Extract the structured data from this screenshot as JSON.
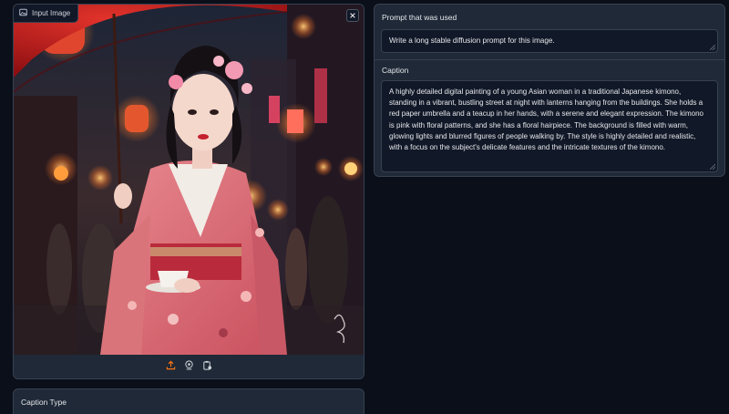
{
  "image_panel": {
    "label": "Input Image",
    "label_icon": "image-icon",
    "close_icon": "close-icon",
    "toolbar": [
      "upload-icon",
      "webcam-icon",
      "clipboard-icon"
    ],
    "accent_color": "#f97316"
  },
  "caption_type": {
    "label": "Caption Type"
  },
  "prompt_field": {
    "label": "Prompt that was used",
    "value": "Write a long stable diffusion prompt for this image."
  },
  "caption_field": {
    "label": "Caption",
    "value": "A highly detailed digital painting of a young Asian woman in a traditional Japanese kimono, standing in a vibrant, bustling street at night with lanterns hanging from the buildings. She holds a red paper umbrella and a teacup in her hands, with a serene and elegant expression. The kimono is pink with floral patterns, and she has a floral hairpiece. The background is filled with warm, glowing lights and blurred figures of people walking by. The style is highly detailed and realistic, with a focus on the subject's delicate features and the intricate textures of the kimono."
  }
}
